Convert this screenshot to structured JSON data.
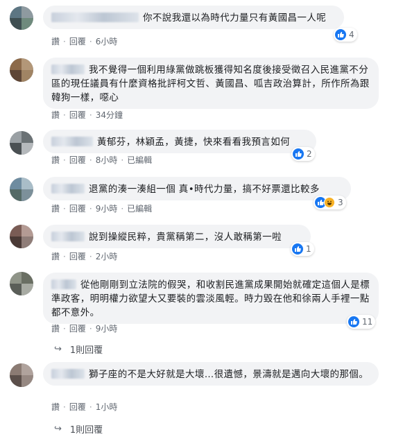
{
  "labels": {
    "like": "讚",
    "reply": "回覆",
    "edited": "已編輯"
  },
  "comments": [
    {
      "text": "你不說我還以為時代力量只有黃國昌一人呢",
      "time": "6小時",
      "reactions": "4"
    },
    {
      "text": "我不覺得一個利用綠黨做跳板獲得知名度後接受徵召入民進黨不分區的現任議員有什麼資格批評柯文哲、黃國昌、呱吉政治算計，所作所為跟韓狗一樣，噁心",
      "time": "34分鐘"
    },
    {
      "text": "黃郁芬，林穎孟，黃捷，快來看看我預言如何",
      "time": "8小時",
      "reactions": "2"
    },
    {
      "text": "退黨的湊一湊組一個 真•時代力量，搞不好票還比較多",
      "time": "9小時",
      "reactions": "3"
    },
    {
      "text": "說到操縱民粹，貴黨稱第二，沒人敢稱第一啦",
      "time": "2小時",
      "reactions": "1"
    },
    {
      "text": "從他剛剛到立法院的假哭，和收割民進黨成果開始就確定這個人是標準政客，明明權力欲望大又要裝的雲淡風輕。時力毀在他和徐兩人手裡一點都不意外。",
      "time": "9小時",
      "reactions": "11",
      "replies": "1則回覆"
    },
    {
      "text": "獅子座的不是大好就是大壞…很遺憾，景濤就是邁向大壞的那個。",
      "time": "1小時",
      "replies": "1則回覆"
    }
  ],
  "colors": {
    "like": "#1877f2",
    "haha": "#f7b125",
    "bubble": "#f2f3f5",
    "meta": "#606770"
  }
}
